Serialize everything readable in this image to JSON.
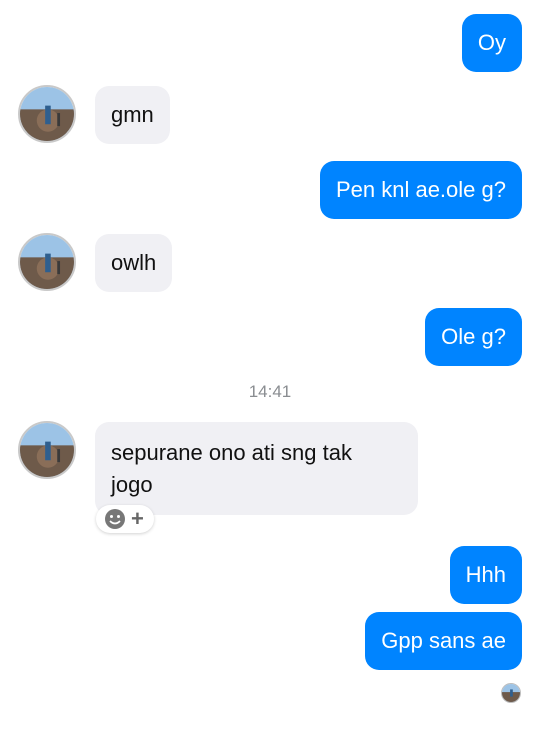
{
  "thread": {
    "messages": [
      {
        "direction": "outgoing",
        "text": "Oy"
      },
      {
        "direction": "incoming",
        "text": "gmn"
      },
      {
        "direction": "outgoing",
        "text": "Pen knl ae.ole g?"
      },
      {
        "direction": "incoming",
        "text": "owlh"
      },
      {
        "direction": "outgoing",
        "text": "Ole g?"
      },
      {
        "direction": "incoming",
        "text": "sepurane ono ati sng tak\njogo"
      },
      {
        "direction": "outgoing",
        "text": "Hhh"
      },
      {
        "direction": "outgoing",
        "text": "Gpp sans ae"
      }
    ],
    "timestamp": "14:41",
    "reaction_bar": {
      "icons": [
        "smile-icon",
        "plus-icon"
      ],
      "plus_glyph": "+"
    }
  },
  "colors": {
    "outgoing_bubble": "#0084ff",
    "incoming_bubble": "#f0f0f4",
    "timestamp_text": "#8a8d91"
  }
}
